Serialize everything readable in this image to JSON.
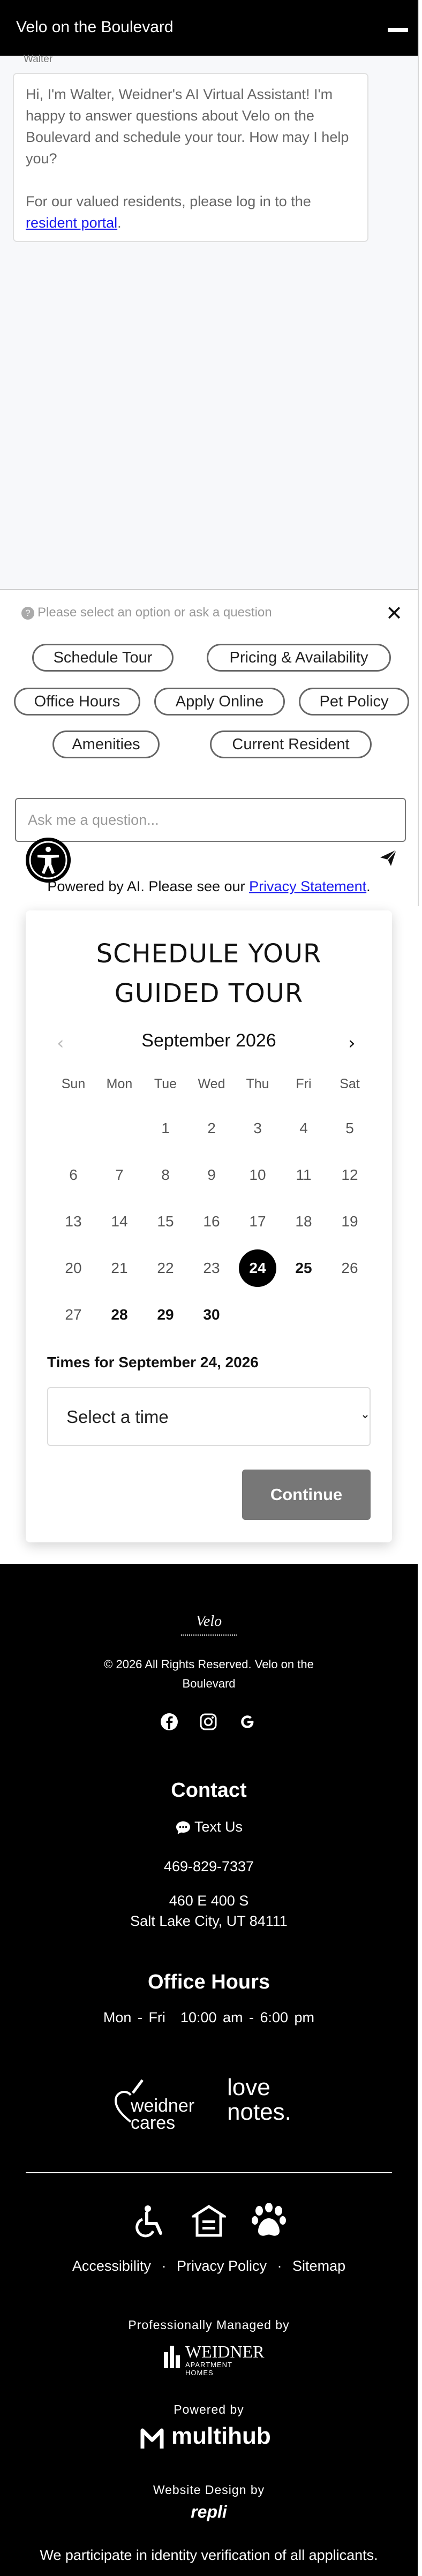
{
  "chat": {
    "title": "Velo on the Boulevard",
    "bot_name": "Walter",
    "greeting": "Hi, I'm Walter, Weidner's AI Virtual Assistant! I'm happy to answer questions about Velo on the Boulevard and schedule your tour. How may I help you?",
    "resident_prefix": "For our valued residents, please log in to the ",
    "resident_link": "resident portal",
    "resident_suffix": ".",
    "options_hint": "Please select an option or ask a question",
    "options": [
      "Schedule Tour",
      "Pricing & Availability",
      "Office Hours",
      "Apply Online",
      "Pet Policy",
      "Amenities",
      "Current Resident"
    ],
    "input_placeholder": "Ask me a question...",
    "powered_prefix": "Powered by AI. Please see our ",
    "privacy_link": "Privacy Statement",
    "powered_suffix": "."
  },
  "tour": {
    "heading_line1": "SCHEDULE YOUR",
    "heading_line2": "GUIDED TOUR",
    "month": "September 2026",
    "weekdays": [
      "Sun",
      "Mon",
      "Tue",
      "Wed",
      "Thu",
      "Fri",
      "Sat"
    ],
    "weeks": [
      [
        "",
        "",
        "1",
        "2",
        "3",
        "4",
        "5"
      ],
      [
        "6",
        "7",
        "8",
        "9",
        "10",
        "11",
        "12"
      ],
      [
        "13",
        "14",
        "15",
        "16",
        "17",
        "18",
        "19"
      ],
      [
        "20",
        "21",
        "22",
        "23",
        "24",
        "25",
        "26"
      ],
      [
        "27",
        "28",
        "29",
        "30",
        "",
        "",
        ""
      ]
    ],
    "selected_day": "24",
    "available_days": [
      "25",
      "28",
      "29",
      "30"
    ],
    "times_label": "Times for September 24, 2026",
    "time_placeholder": "Select a time",
    "continue_label": "Continue"
  },
  "footer": {
    "logo_text": "Velo",
    "copyright_line1": "© 2026 All Rights Reserved. Velo on the",
    "copyright_line2": "Boulevard",
    "contact_heading": "Contact",
    "text_us": "Text Us",
    "phone": "469-829-7337",
    "address_line1": "460 E 400 S",
    "address_line2": "Salt Lake City, UT 84111",
    "office_heading": "Office Hours",
    "office_days": "Mon - Fri",
    "office_time": "10:00 am - 6:00 pm",
    "weidner_cares": "weidner cares",
    "love_notes_line1": "love",
    "love_notes_line2": "notes.",
    "links": [
      "Accessibility",
      "Privacy Policy",
      "Sitemap"
    ],
    "link_sep": "·",
    "managed_by": "Professionally Managed by",
    "weidner_name": "WEIDNER",
    "weidner_sub": "APARTMENT HOMES",
    "powered_by": "Powered by",
    "multihub": "multihub",
    "design_by": "Website Design by",
    "repli": "repli",
    "identity_note": "We participate in identity verification of all applicants."
  },
  "colors": {
    "header_bg": "#000000",
    "link": "#1a1aee",
    "selected_day_bg": "#000000",
    "continue_bg": "#777777",
    "footer_bg": "#000000"
  }
}
